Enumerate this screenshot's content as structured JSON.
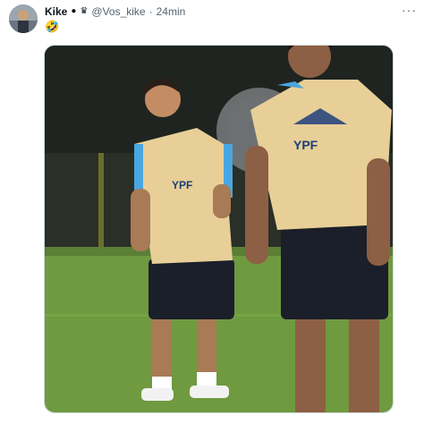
{
  "tweet": {
    "author_name": "Kike",
    "badges": [
      "apple-icon",
      "crown-icon"
    ],
    "handle": "@Vos_kike",
    "separator": "·",
    "time": "24min",
    "text": "🤣",
    "more_label": "···"
  },
  "media": {
    "jersey_text_left": "YPF",
    "jersey_text_right": "YPF"
  },
  "colors": {
    "name": "#0f1419",
    "secondary": "#536471",
    "pitch": "#6f9a3f",
    "jersey": "#e7cf97",
    "jersey_trim": "#4aa6e0",
    "shorts": "#1b1f2a"
  }
}
